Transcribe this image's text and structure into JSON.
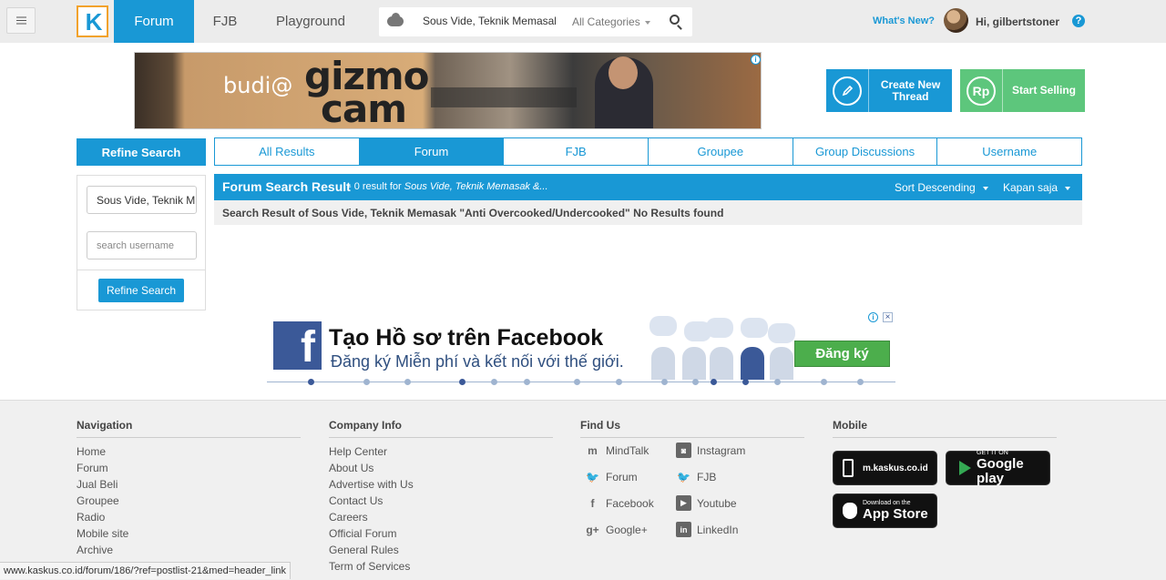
{
  "header": {
    "logo": "K",
    "nav": [
      "Forum",
      "FJB",
      "Playground"
    ],
    "active_nav": "Forum",
    "search": {
      "query": "Sous Vide, Teknik Memasak",
      "category": "All Categories"
    },
    "whats_new": "What's New?",
    "greeting": "Hi, gilbertstoner",
    "help": "?"
  },
  "top_ad": {
    "brand_prefix": "budi@",
    "brand_line1": "gizmo",
    "brand_line2": "cam"
  },
  "actions": {
    "create_thread": {
      "line1": "Create New",
      "line2": "Thread",
      "color": "#1998d5"
    },
    "start_selling": {
      "label": "Start Selling",
      "icon_text": "Rp",
      "color": "#5dc67c"
    }
  },
  "refine": {
    "title": "Refine Search",
    "keyword_value": "Sous Vide, Teknik M",
    "username_placeholder": "search username",
    "button": "Refine Search"
  },
  "result_tabs": [
    "All Results",
    "Forum",
    "FJB",
    "Groupee",
    "Group Discussions",
    "Username"
  ],
  "active_result_tab": "Forum",
  "results": {
    "title": "Forum Search Result",
    "count_text": "- 0 result for",
    "query_italic": "Sous Vide, Teknik Memasak &...",
    "sort": "Sort Descending",
    "time": "Kapan saja",
    "message": "Search Result of Sous Vide, Teknik Memasak \"Anti Overcooked/Undercooked\" No Results found"
  },
  "mid_ad": {
    "title": "Tạo Hồ sơ trên Facebook",
    "subtitle": "Đăng ký Miễn phí và kết nối với thế giới.",
    "button": "Đăng ký"
  },
  "footer": {
    "navigation": {
      "title": "Navigation",
      "links": [
        "Home",
        "Forum",
        "Jual Beli",
        "Groupee",
        "Radio",
        "Mobile site",
        "Archive"
      ]
    },
    "company": {
      "title": "Company Info",
      "links": [
        "Help Center",
        "About Us",
        "Advertise with Us",
        "Contact Us",
        "Careers",
        "Official Forum",
        "General Rules",
        "Term of Services"
      ]
    },
    "find_us": {
      "title": "Find Us",
      "left": [
        "MindTalk",
        "Forum",
        "Facebook",
        "Google+"
      ],
      "right": [
        "Instagram",
        "FJB",
        "Youtube",
        "LinkedIn"
      ]
    },
    "mobile": {
      "title": "Mobile",
      "site": "m.kaskus.co.id",
      "google_small": "GET IT ON",
      "google_big": "Google play",
      "apple_small": "Download on the",
      "apple_big": "App Store"
    }
  },
  "status_url": "www.kaskus.co.id/forum/186/?ref=postlist-21&med=header_link"
}
